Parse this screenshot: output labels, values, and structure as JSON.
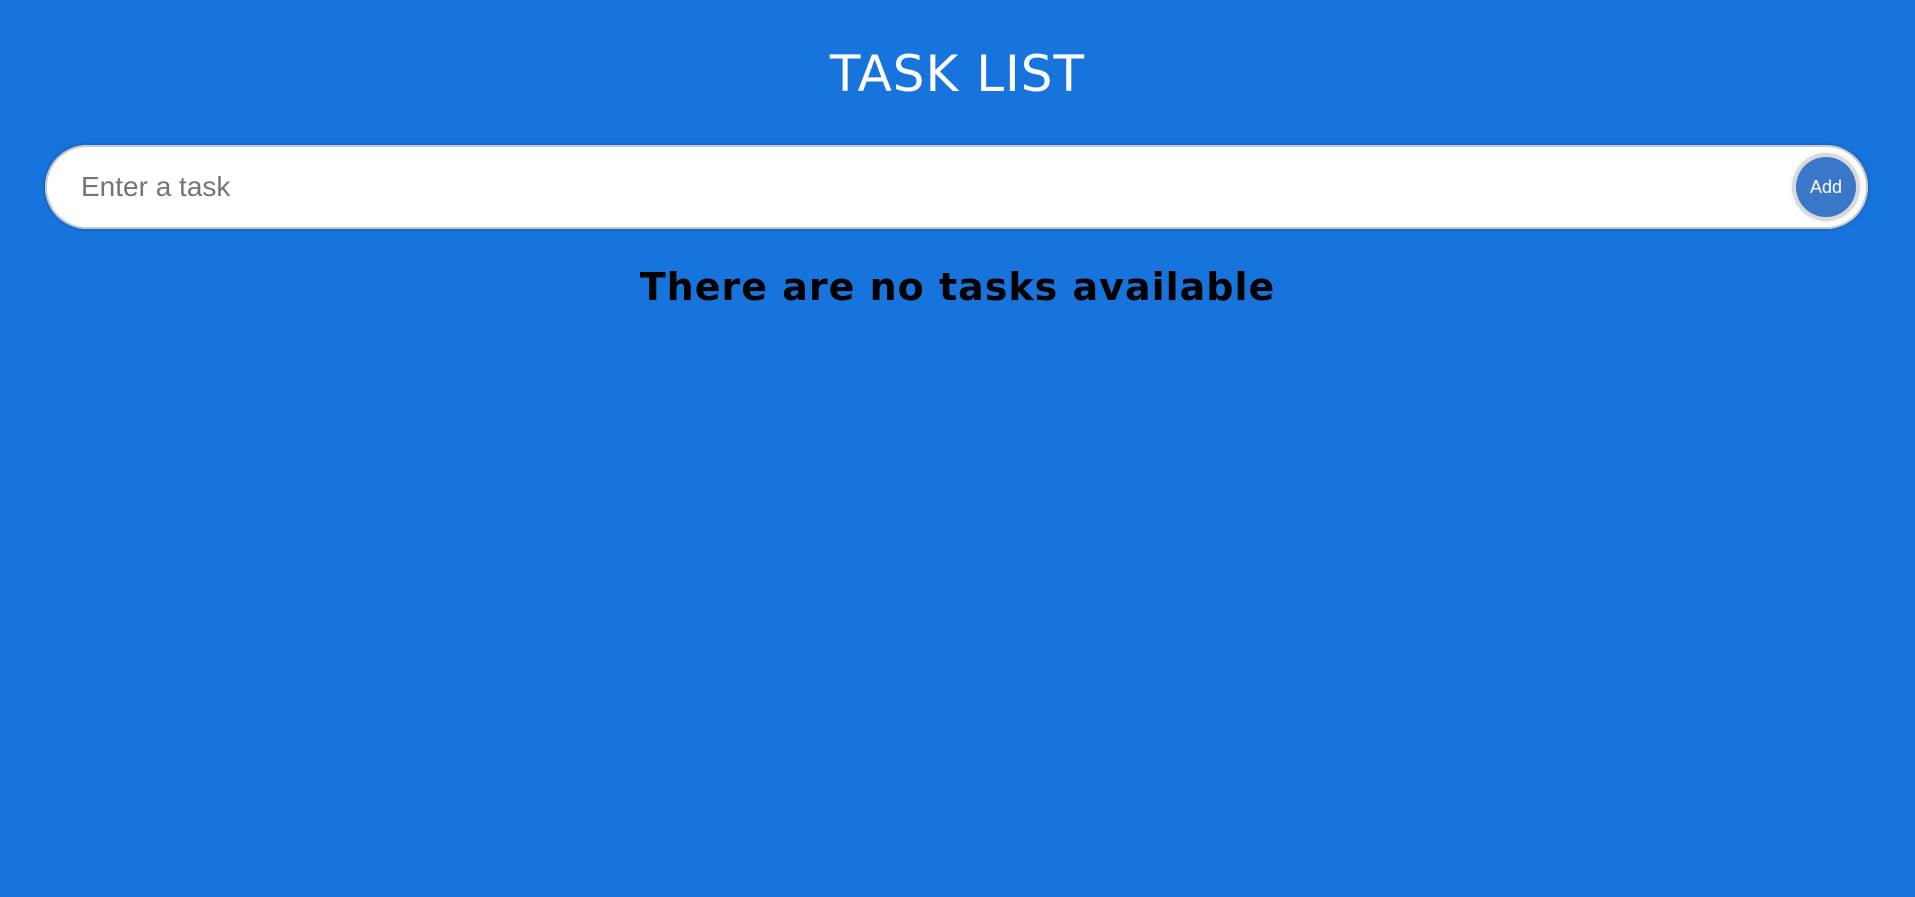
{
  "header": {
    "title": "TASK LIST"
  },
  "task_form": {
    "input_value": "",
    "input_placeholder": "Enter a task",
    "add_label": "Add"
  },
  "tasks": {
    "empty_message": "There are no tasks available"
  },
  "colors": {
    "background": "#1774dc",
    "title_text": "#ffffff",
    "add_button": "#3a77c8",
    "input_background": "#ffffff",
    "empty_message_text": "#000000"
  }
}
